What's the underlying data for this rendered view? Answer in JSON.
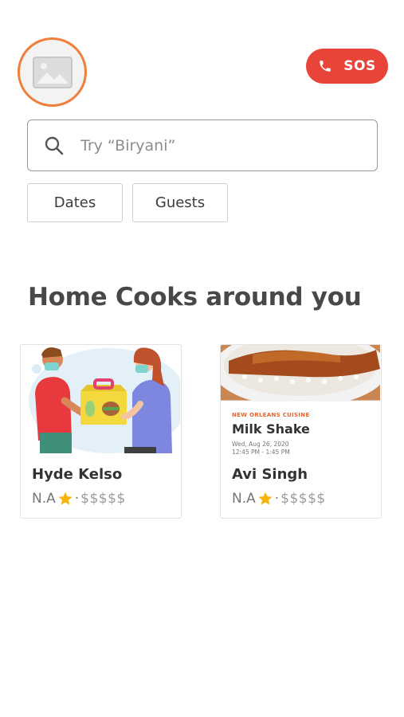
{
  "header": {
    "sos_label": "SOS",
    "avatar_icon": "image-placeholder-icon",
    "accent_color": "#f07f3c",
    "sos_color": "#e8443a"
  },
  "search": {
    "placeholder": "Try “Biryani”",
    "value": ""
  },
  "filters": {
    "dates_label": "Dates",
    "guests_label": "Guests"
  },
  "section": {
    "title": "Home Cooks around you"
  },
  "cooks": [
    {
      "name": "Hyde Kelso",
      "rating": "N.A",
      "price": "$$$$$",
      "image": "delivery-illustration"
    },
    {
      "name": "Avi Singh",
      "rating": "N.A",
      "price": "$$$$$",
      "image": "food-promo",
      "promo": {
        "category": "NEW ORLEANS CUISINE",
        "title": "Milk Shake",
        "date": "Wed, Aug 26, 2020",
        "time": "12:45 PM - 1:45 PM"
      }
    }
  ]
}
